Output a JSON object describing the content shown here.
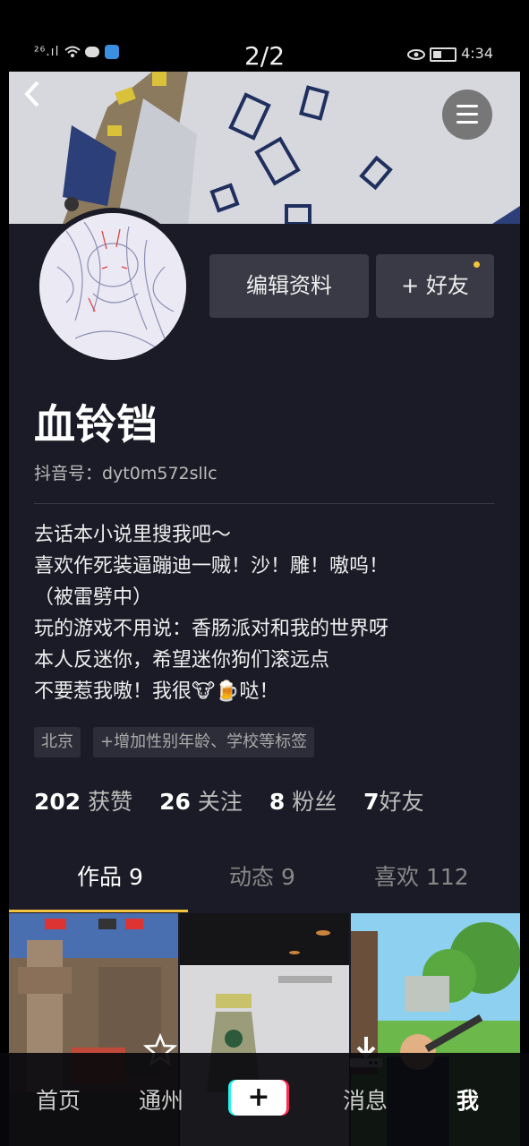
{
  "status_bar": {
    "signal_text": "²⁶.ıl",
    "page_indicator": "2/2",
    "time": "4:34",
    "battery_level": 0.4
  },
  "profile": {
    "name": "血铃铛",
    "douyin_id": "抖音号：dyt0m572sllc",
    "edit_label": "编辑资料",
    "add_friend_label": "+ 好友",
    "bio": "去话本小说里搜我吧～\n喜欢作死装逼蹦迪一贼！沙！雕！嗷呜！\n（被雷劈中）\n玩的游戏不用说：香肠派对和我的世界呀\n本人反迷你，希望迷你狗们滚远点\n不要惹我嗷！我很🐮🍺哒！",
    "tags": {
      "location": "北京",
      "add": "+增加性别年龄、学校等标签"
    },
    "stats": {
      "likes_count": "202",
      "likes_label": "获赞",
      "following_count": "26",
      "following_label": "关注",
      "followers_count": "8",
      "followers_label": "粉丝",
      "friends_count": "7",
      "friends_label": "好友"
    }
  },
  "tabs": {
    "works": "作品 9",
    "dynamic": "动态 9",
    "likes": "喜欢 112"
  },
  "bottom_nav": {
    "home": "首页",
    "city": "通州",
    "messages": "消息",
    "me": "我"
  },
  "icons": {
    "back": "chevron-left-icon",
    "menu": "hamburger-menu-icon",
    "star": "star-icon",
    "download": "download-icon",
    "plus": "plus-icon"
  },
  "colors": {
    "background": "#1a1b26",
    "accent": "#f5c23d",
    "button": "#393a45"
  }
}
